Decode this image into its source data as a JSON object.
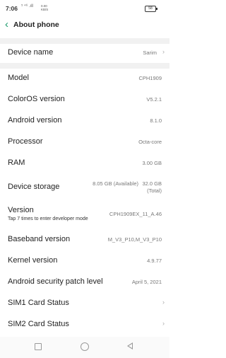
{
  "status_bar": {
    "time": "7:06",
    "indicators": "⁵ ⁴⁶ .ıll",
    "network_speed_value": "0.00",
    "network_speed_unit": "KB/S",
    "battery": "58"
  },
  "header": {
    "back_icon": "chevron-left-icon",
    "title": "About phone"
  },
  "device_name": {
    "label": "Device name",
    "value": "Sarim"
  },
  "rows": {
    "model": {
      "label": "Model",
      "value": "CPH1909"
    },
    "coloros": {
      "label": "ColorOS version",
      "value": "V5.2.1"
    },
    "android": {
      "label": "Android version",
      "value": "8.1.0"
    },
    "processor": {
      "label": "Processor",
      "value": "Octa-core"
    },
    "ram": {
      "label": "RAM",
      "value": "3.00 GB"
    },
    "storage": {
      "label": "Device storage",
      "available": "8.05 GB (Available)",
      "total_value": "32.0 GB",
      "total_label": "(Total)"
    },
    "version": {
      "label": "Version",
      "sub": "Tap 7 times to enter developer mode",
      "value": "CPH1909EX_11_A.46"
    },
    "baseband": {
      "label": "Baseband version",
      "value": "M_V3_P10,M_V3_P10"
    },
    "kernel": {
      "label": "Kernel version",
      "value": "4.9.77"
    },
    "security_patch": {
      "label": "Android security patch level",
      "value": "April 5, 2021"
    },
    "sim1": {
      "label": "SIM1 Card Status"
    },
    "sim2": {
      "label": "SIM2 Card Status"
    }
  },
  "nav_bar": {
    "recents_icon": "square-icon",
    "home_icon": "circle-icon",
    "back_icon": "triangle-back-icon"
  },
  "colors": {
    "accent": "#1a9b6c",
    "band": "#f1f1f1"
  }
}
